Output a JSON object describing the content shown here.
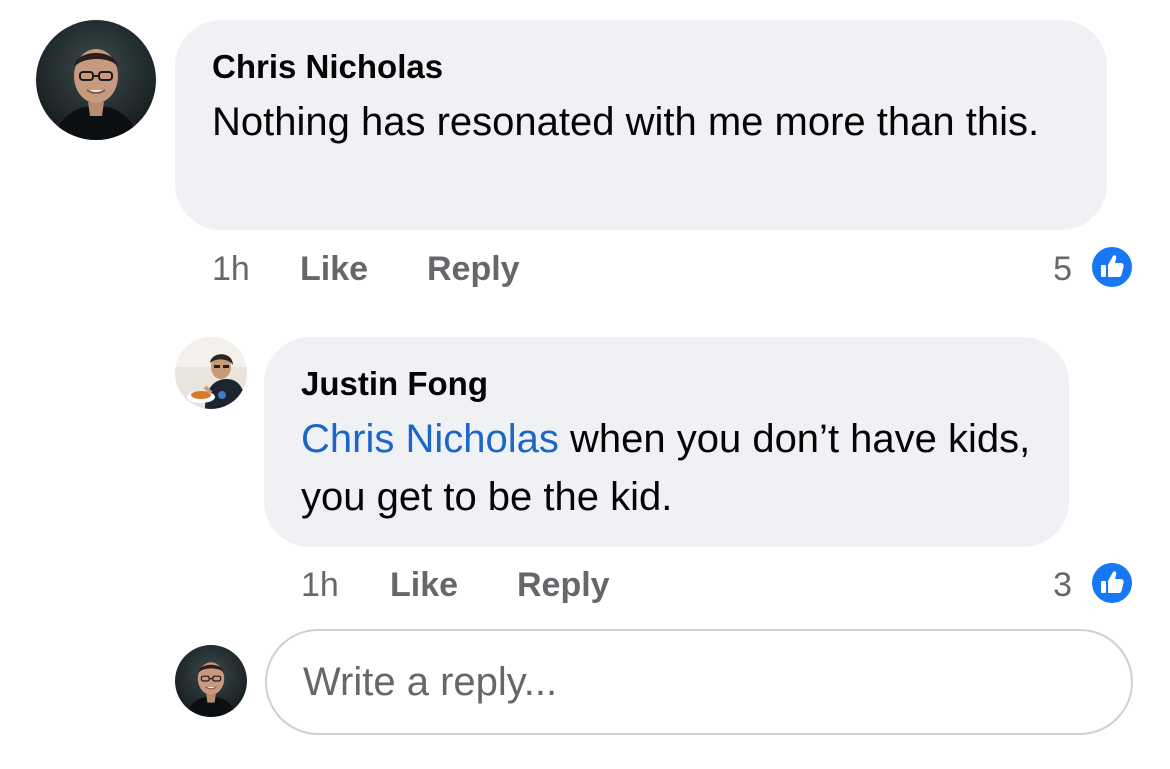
{
  "comments": [
    {
      "author": "Chris Nicholas",
      "text": "Nothing has resonated with me more than this.",
      "time": "1h",
      "like_label": "Like",
      "reply_label": "Reply",
      "reaction_count": "5",
      "reaction_icon": "thumbs-up-icon"
    }
  ],
  "replies": [
    {
      "author": "Justin Fong",
      "mention": "Chris Nicholas",
      "text": " when you don’t have kids, you get to be the kid.",
      "time": "1h",
      "like_label": "Like",
      "reply_label": "Reply",
      "reaction_count": "3",
      "reaction_icon": "thumbs-up-icon"
    }
  ],
  "reply_box": {
    "placeholder": "Write a reply..."
  },
  "colors": {
    "bubble": "#f0f1f5",
    "mention": "#1b66c9",
    "muted": "#65676b",
    "like_blue": "#1877f2"
  }
}
